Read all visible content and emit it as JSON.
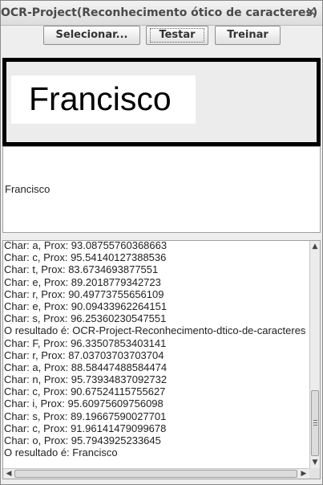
{
  "window": {
    "title": "OCR-Project(Reconhecimento ótico de caracteres)",
    "close_icon": "close-icon",
    "close_glyph": "✕"
  },
  "toolbar": {
    "select_label": "Selecionar...",
    "test_label": "Testar",
    "train_label": "Treinar"
  },
  "image_preview": {
    "word": "Francisco"
  },
  "recognized_text": "Francisco",
  "log": {
    "lines": [
      "Char: a, Prox: 93.08755760368663",
      "Char: c, Prox: 95.54140127388536",
      "Char: t, Prox: 83.6734693877551",
      "Char: e, Prox: 89.2018779342723",
      "Char: r, Prox: 90.49773755656109",
      "Char: e, Prox: 90.09433962264151",
      "Char: s, Prox: 96.25360230547551",
      "O resultado é: OCR-Project-Reconhecimento-dtico-de-caracteres",
      "Char: F, Prox: 96.33507853403141",
      "Char: r, Prox: 87.03703703703704",
      "Char: a, Prox: 88.58447488584474",
      "Char: n, Prox: 95.73934837092732",
      "Char: c, Prox: 90.67524115755627",
      "Char: i, Prox: 95.60975609756098",
      "Char: s, Prox: 89.19667590027701",
      "Char: c, Prox: 91.96141479099678",
      "Char: o, Prox: 95.7943925233645",
      "O resultado é: Francisco"
    ]
  },
  "scrollbars": {
    "up_arrow": "▲",
    "down_arrow": "▼",
    "left_arrow": "◀",
    "right_arrow": "▶"
  }
}
